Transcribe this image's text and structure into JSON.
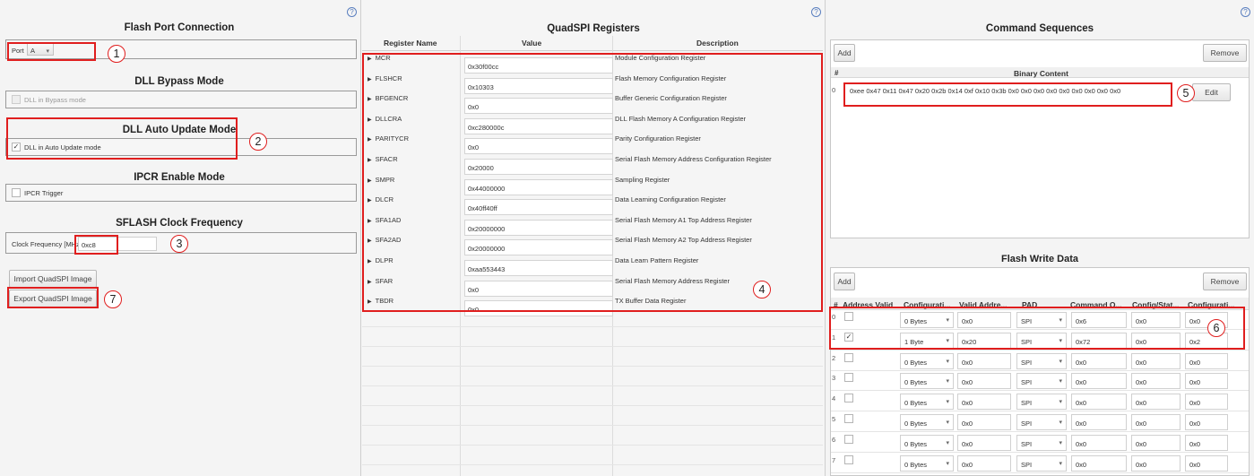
{
  "help_glyph": "?",
  "flash_port": {
    "title": "Flash Port Connection",
    "port_label": "Port",
    "port_value": "A",
    "dll_bypass_title": "DLL Bypass Mode",
    "dll_bypass_label": "DLL in Bypass mode",
    "dll_auto_title": "DLL Auto Update Mode",
    "dll_auto_label": "DLL in Auto Update mode",
    "ipcr_title": "IPCR Enable Mode",
    "ipcr_label": "IPCR Trigger",
    "sflash_title": "SFLASH Clock Frequency",
    "clock_label": "Clock Frequency [MHz]",
    "clock_value": "0xc8",
    "import_label": "Import QuadSPI Image",
    "export_label": "Export QuadSPI Image"
  },
  "quadspi": {
    "title": "QuadSPI Registers",
    "headers": [
      "Register Name",
      "Value",
      "Description"
    ],
    "rows": [
      {
        "name": "MCR",
        "value": "0x30f00cc",
        "desc": "Module Configuration Register"
      },
      {
        "name": "FLSHCR",
        "value": "0x10303",
        "desc": "Flash Memory Configuration Register"
      },
      {
        "name": "BFGENCR",
        "value": "0x0",
        "desc": "Buffer Generic Configuration Register"
      },
      {
        "name": "DLLCRA",
        "value": "0xc280000c",
        "desc": "DLL Flash Memory A Configuration Register"
      },
      {
        "name": "PARITYCR",
        "value": "0x0",
        "desc": "Parity Configuration Register"
      },
      {
        "name": "SFACR",
        "value": "0x20000",
        "desc": "Serial Flash Memory Address Configuration Register"
      },
      {
        "name": "SMPR",
        "value": "0x44000000",
        "desc": "Sampling Register"
      },
      {
        "name": "DLCR",
        "value": "0x40ff40ff",
        "desc": "Data Learning Configuration Register"
      },
      {
        "name": "SFA1AD",
        "value": "0x20000000",
        "desc": "Serial Flash Memory A1 Top Address Register"
      },
      {
        "name": "SFA2AD",
        "value": "0x20000000",
        "desc": "Serial Flash Memory A2 Top Address Register"
      },
      {
        "name": "DLPR",
        "value": "0xaa553443",
        "desc": "Data Learn Pattern Register"
      },
      {
        "name": "SFAR",
        "value": "0x0",
        "desc": "Serial Flash Memory Address Register"
      },
      {
        "name": "TBDR",
        "value": "0x0",
        "desc": "TX Buffer Data Register"
      }
    ]
  },
  "command_sequences": {
    "title": "Command Sequences",
    "add_label": "Add",
    "remove_label": "Remove",
    "col_index": "#",
    "col_binary": "Binary Content",
    "row_index": "0",
    "binary_content": "0xee 0x47 0x11 0x47 0x20 0x2b 0x14 0xf 0x10 0x3b 0x0 0x0 0x0 0x0 0x0 0x0 0x0 0x0 0x0",
    "edit_label": "Edit"
  },
  "flash_write": {
    "title": "Flash Write Data",
    "add_label": "Add",
    "remove_label": "Remove",
    "headers": [
      "#",
      "Address Valid",
      "Configurati...",
      "Valid Addre...",
      "PAD",
      "Command O...",
      "Config/Stat...",
      "Configurati..."
    ],
    "rows": [
      {
        "idx": "0",
        "checked": false,
        "config": "0 Bytes",
        "addr": "0x0",
        "pad": "SPI",
        "cmd": "0x6",
        "stat": "0x0",
        "cfg": "0x0"
      },
      {
        "idx": "1",
        "checked": true,
        "config": "1 Byte",
        "addr": "0x20",
        "pad": "SPI",
        "cmd": "0x72",
        "stat": "0x0",
        "cfg": "0x2"
      },
      {
        "idx": "2",
        "checked": false,
        "config": "0 Bytes",
        "addr": "0x0",
        "pad": "SPI",
        "cmd": "0x0",
        "stat": "0x0",
        "cfg": "0x0"
      },
      {
        "idx": "3",
        "checked": false,
        "config": "0 Bytes",
        "addr": "0x0",
        "pad": "SPI",
        "cmd": "0x0",
        "stat": "0x0",
        "cfg": "0x0"
      },
      {
        "idx": "4",
        "checked": false,
        "config": "0 Bytes",
        "addr": "0x0",
        "pad": "SPI",
        "cmd": "0x0",
        "stat": "0x0",
        "cfg": "0x0"
      },
      {
        "idx": "5",
        "checked": false,
        "config": "0 Bytes",
        "addr": "0x0",
        "pad": "SPI",
        "cmd": "0x0",
        "stat": "0x0",
        "cfg": "0x0"
      },
      {
        "idx": "6",
        "checked": false,
        "config": "0 Bytes",
        "addr": "0x0",
        "pad": "SPI",
        "cmd": "0x0",
        "stat": "0x0",
        "cfg": "0x0"
      },
      {
        "idx": "7",
        "checked": false,
        "config": "0 Bytes",
        "addr": "0x0",
        "pad": "SPI",
        "cmd": "0x0",
        "stat": "0x0",
        "cfg": "0x0"
      }
    ]
  },
  "callouts": [
    "1",
    "2",
    "3",
    "4",
    "5",
    "6",
    "7"
  ],
  "colors": {
    "highlight": "#e01e1e",
    "help": "#5a7fbf"
  }
}
